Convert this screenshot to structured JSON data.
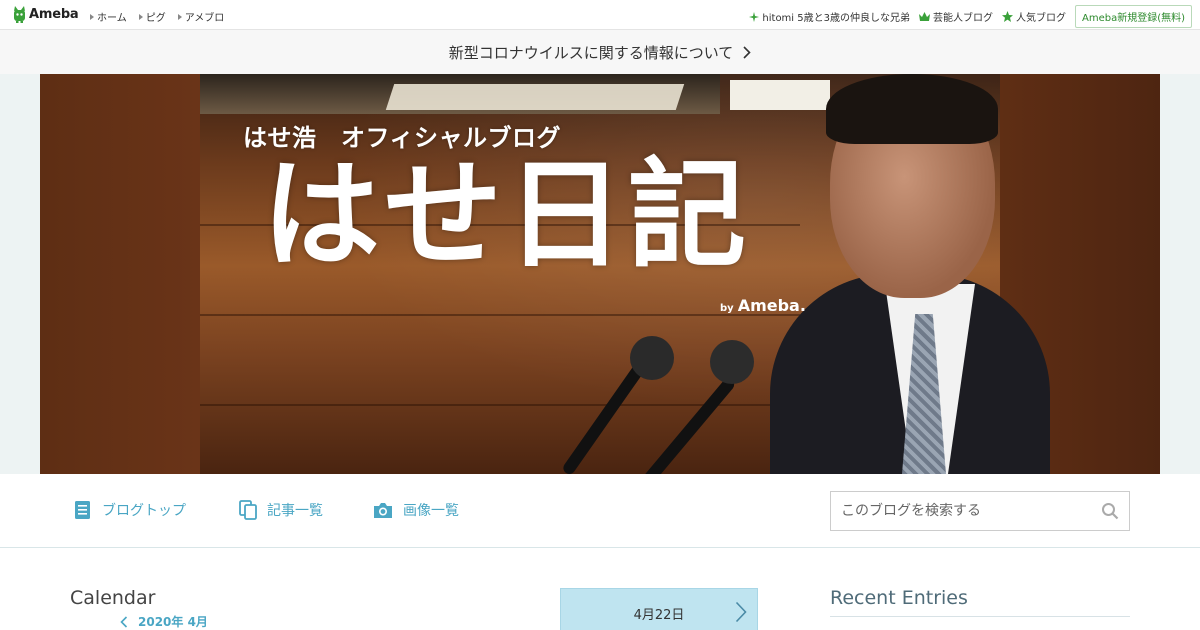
{
  "topbar": {
    "logo_text": "Ameba",
    "nav": [
      {
        "label": "ホーム"
      },
      {
        "label": "ピグ"
      },
      {
        "label": "アメブロ"
      }
    ],
    "right_links": [
      {
        "label": "hitomi 5歳と3歳の仲良しな兄弟",
        "icon": "sparkle-icon"
      },
      {
        "label": "芸能人ブログ",
        "icon": "crown-icon"
      },
      {
        "label": "人気ブログ",
        "icon": "star-icon"
      }
    ],
    "signup_label": "Ameba新規登録(無料)"
  },
  "notice": {
    "text": "新型コロナウイルスに関する情報について"
  },
  "hero": {
    "subtitle": "はせ浩　オフィシャルブログ",
    "title": "はせ日記",
    "by": "by",
    "brand": "Ameba."
  },
  "blognav": {
    "items": [
      {
        "label": "ブログトップ",
        "icon": "document-icon"
      },
      {
        "label": "記事一覧",
        "icon": "copy-icon"
      },
      {
        "label": "画像一覧",
        "icon": "camera-icon"
      }
    ],
    "search_placeholder": "このブログを検索する"
  },
  "calendar": {
    "title": "Calendar",
    "month": "2020年 4月"
  },
  "date_box": {
    "label": "4月22日"
  },
  "recent": {
    "title": "Recent Entries"
  },
  "colors": {
    "accent": "#4aa6c4",
    "date_box_bg": "#bfe4f0",
    "ameba_green": "#2d8a2d"
  }
}
